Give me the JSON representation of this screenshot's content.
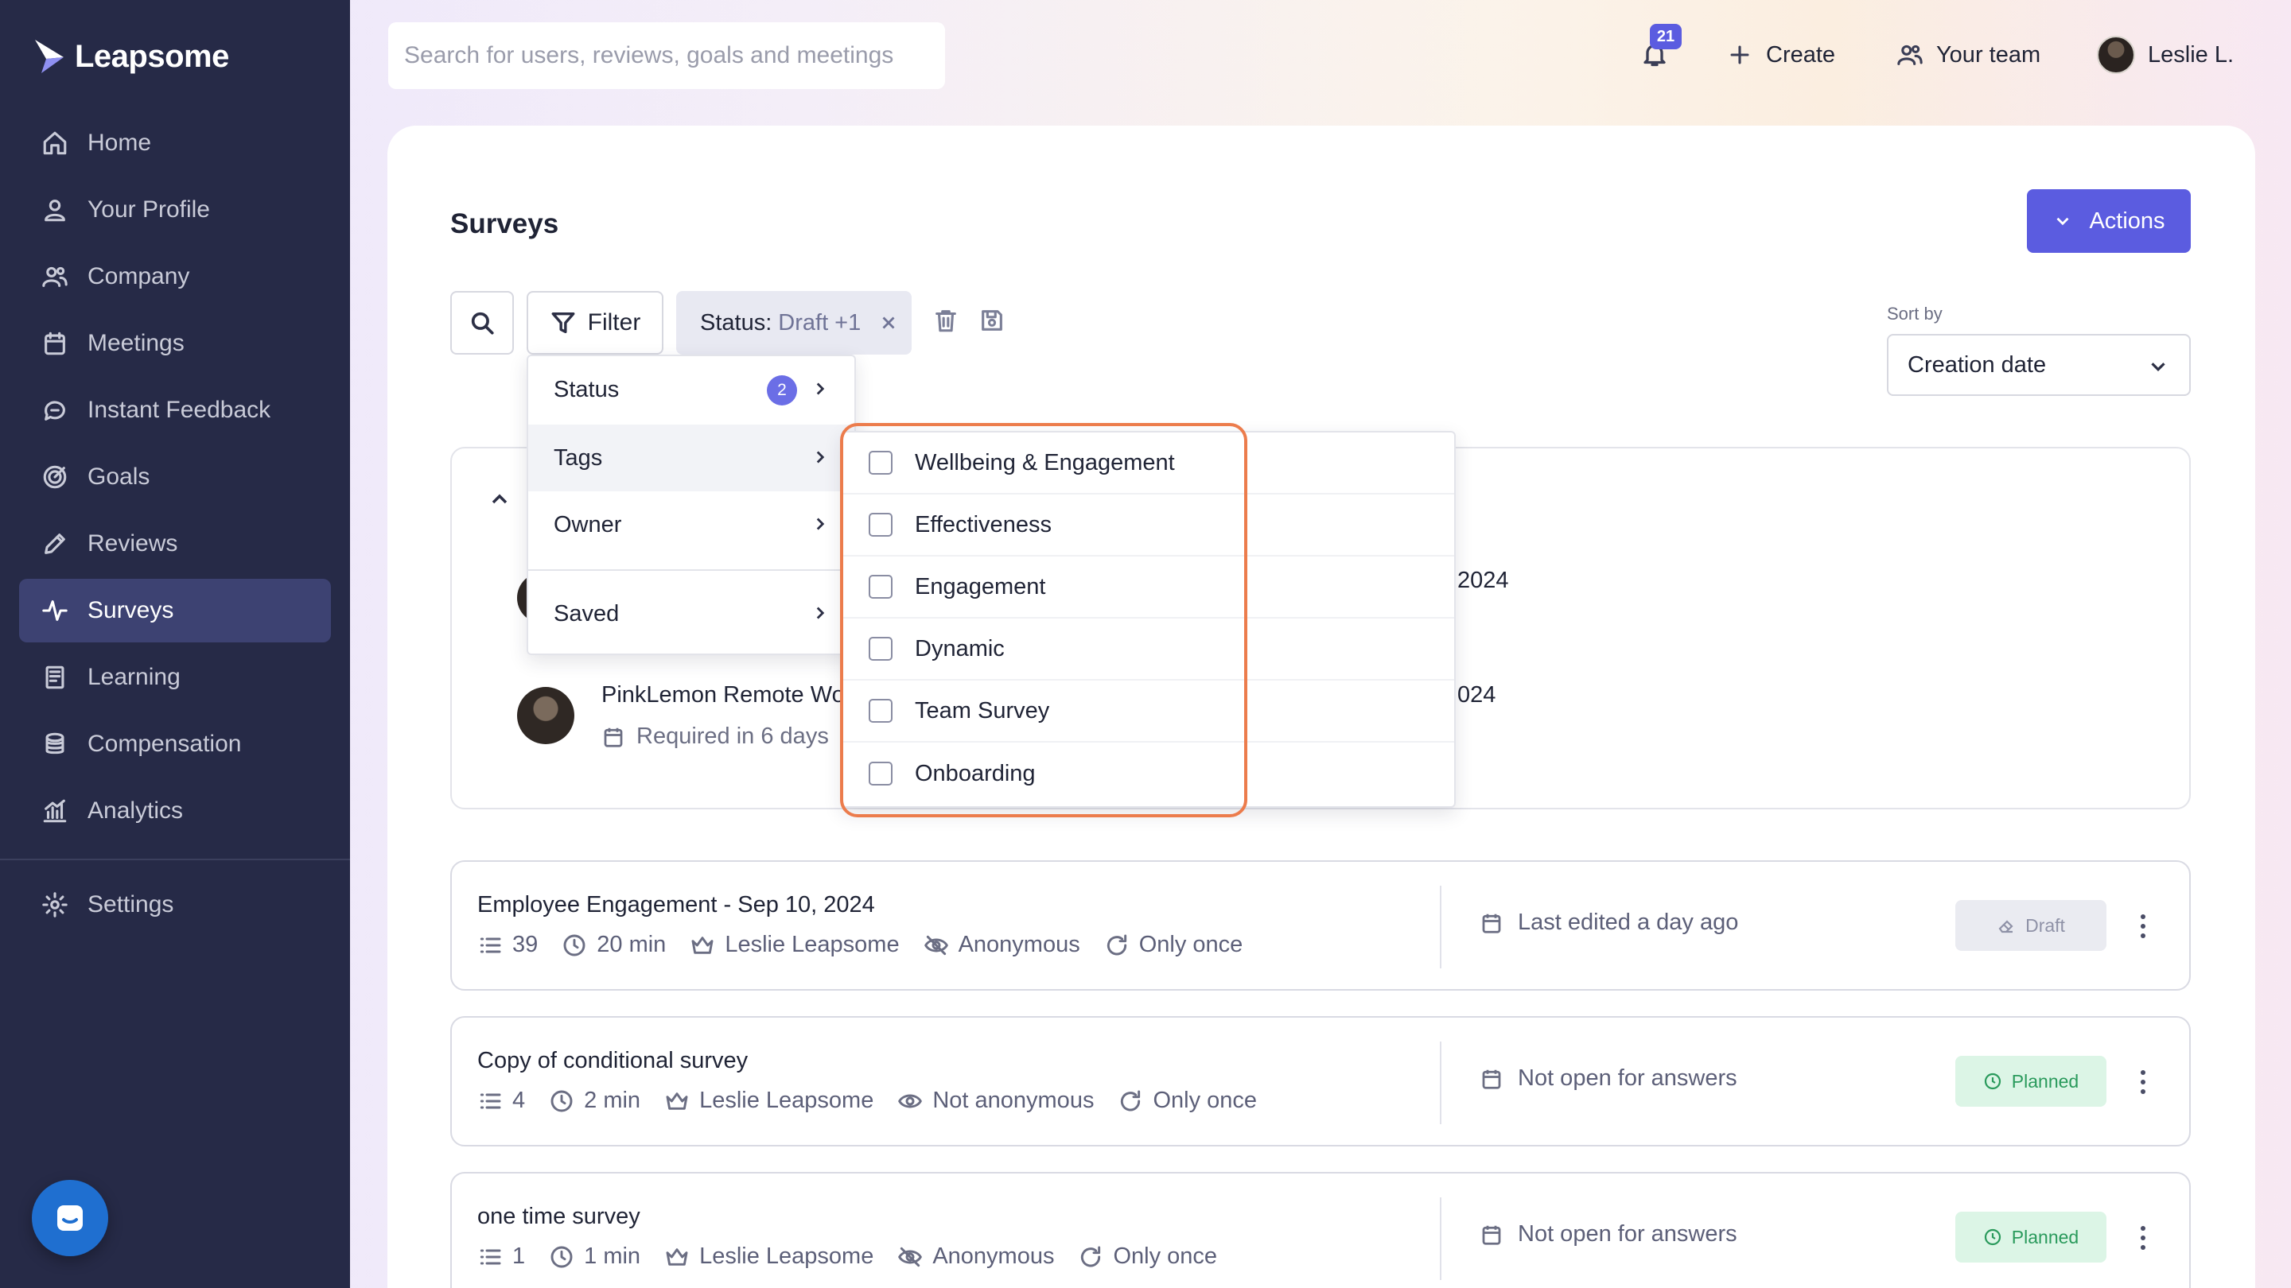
{
  "app": {
    "name": "Leapsome"
  },
  "sidebar": {
    "items": [
      {
        "label": "Home",
        "icon": "home-icon"
      },
      {
        "label": "Your Profile",
        "icon": "user-icon"
      },
      {
        "label": "Company",
        "icon": "users-icon"
      },
      {
        "label": "Meetings",
        "icon": "calendar-icon"
      },
      {
        "label": "Instant Feedback",
        "icon": "chat-icon"
      },
      {
        "label": "Goals",
        "icon": "target-icon"
      },
      {
        "label": "Reviews",
        "icon": "pencil-icon"
      },
      {
        "label": "Surveys",
        "icon": "pulse-icon",
        "active": true
      },
      {
        "label": "Learning",
        "icon": "book-icon"
      },
      {
        "label": "Compensation",
        "icon": "coins-icon"
      },
      {
        "label": "Analytics",
        "icon": "chart-icon"
      }
    ],
    "settings_label": "Settings"
  },
  "topbar": {
    "search_placeholder": "Search for users, reviews, goals and meetings",
    "notification_count": "21",
    "create_label": "Create",
    "team_label": "Your team",
    "user_name": "Leslie L."
  },
  "page": {
    "title": "Surveys",
    "actions_label": "Actions",
    "filter_label": "Filter",
    "chip_key": "Status:",
    "chip_value": "Draft +1",
    "sort_label": "Sort by",
    "sort_value": "Creation date"
  },
  "filter_menu": {
    "items": [
      {
        "label": "Status",
        "count": "2"
      },
      {
        "label": "Tags"
      },
      {
        "label": "Owner"
      },
      {
        "label": "Saved"
      }
    ]
  },
  "tags_menu": {
    "items": [
      "Wellbeing & Engagement",
      "Effectiveness",
      "Engagement",
      "Dynamic",
      "Team Survey",
      "Onboarding"
    ]
  },
  "group": {
    "row1_date_fragment": "2024",
    "row2_title_fragment": "PinkLemon Remote Wo",
    "row2_sub": "Required in 6 days",
    "row2_date_fragment": "024"
  },
  "surveys": [
    {
      "title": "Employee Engagement - Sep 10, 2024",
      "questions": "39",
      "duration": "20 min",
      "owner": "Leslie Leapsome",
      "privacy": "Anonymous",
      "frequency": "Only once",
      "status_text": "Last edited a day ago",
      "badge": "Draft"
    },
    {
      "title": "Copy of conditional survey",
      "questions": "4",
      "duration": "2 min",
      "owner": "Leslie Leapsome",
      "privacy": "Not anonymous",
      "frequency": "Only once",
      "status_text": "Not open for answers",
      "badge": "Planned"
    },
    {
      "title": "one time survey",
      "questions": "1",
      "duration": "1 min",
      "owner": "Leslie Leapsome",
      "privacy": "Anonymous",
      "frequency": "Only once",
      "status_text": "Not open for answers",
      "badge": "Planned"
    }
  ],
  "colors": {
    "sidebar": "#262a47",
    "accent": "#5b5ce0",
    "highlight": "#ec7c4c",
    "planned": "#2a9a5c"
  }
}
